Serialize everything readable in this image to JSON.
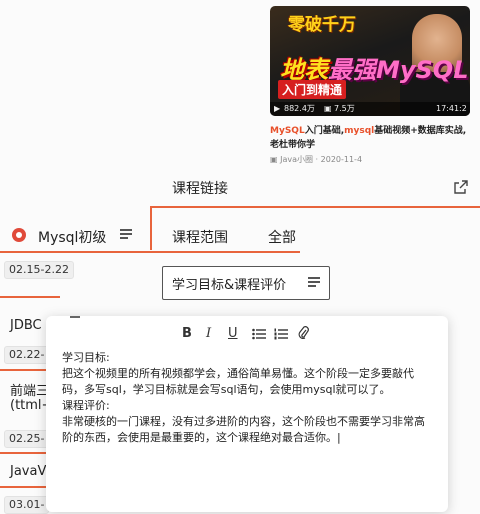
{
  "video_card": {
    "thumb_top_text": "零破千万",
    "thumb_big_text": "地表",
    "thumb_big_text2": "最强MySQL",
    "thumb_red_text": "入门到精通",
    "views": "882.4万",
    "danmaku": "7.5万",
    "duration": "17:41:2",
    "title_hl1": "MySQL",
    "title_part2": "入门基础,",
    "title_hl2": "mysql",
    "title_part3": "基础视频+数据库实战,老杜带你学",
    "author_date": "Java小圈 · 2020-11-4"
  },
  "course": {
    "link_title": "课程链接",
    "mysql_label": "Mysql初级",
    "scope_label": "课程范围",
    "scope_value": "全部",
    "goal_label": "学习目标&课程评价"
  },
  "sidebar": {
    "items": [
      {
        "date": "02.15-2.22"
      },
      {
        "label": "JDBC",
        "date": "02.22-"
      },
      {
        "label": "前端三",
        "label2": "(ttml+",
        "date": "02.25-"
      },
      {
        "label": "JavaV",
        "date": "03.01-"
      }
    ]
  },
  "editor": {
    "toolbar": {
      "bold": "B",
      "italic": "I",
      "underline": "U"
    },
    "content": [
      "学习目标:",
      "把这个视频里的所有视频都学会，通俗简单易懂。这个阶段一定多要敲代码，多写sql，学习目标就是会写sql语句，会使用mysql就可以了。",
      "课程评价:",
      "非常硬核的一门课程，没有过多进阶的内容，这个阶段也不需要学习非常高阶的东西，会使用是最重要的，这个课程绝对最合适你。|"
    ]
  },
  "colors": {
    "accent": "#e8643c",
    "red": "#e04a3a"
  }
}
